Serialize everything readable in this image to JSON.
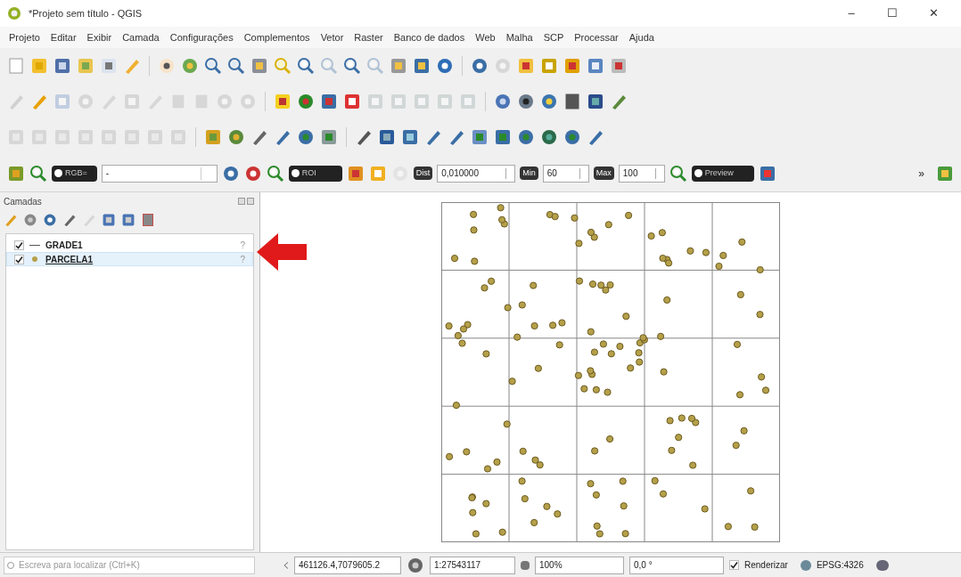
{
  "window": {
    "title": "*Projeto sem título - QGIS",
    "controls": [
      "–",
      "☐",
      "✕"
    ]
  },
  "menu": [
    "Projeto",
    "Editar",
    "Exibir",
    "Camada",
    "Configurações",
    "Complementos",
    "Vetor",
    "Raster",
    "Banco de dados",
    "Web",
    "Malha",
    "SCP",
    "Processar",
    "Ajuda"
  ],
  "scp_toolbar": {
    "band_set": "RGB=",
    "band_value": "-",
    "roi_label": "ROI",
    "dist_label": "Dist",
    "dist_value": "0,010000",
    "min_label": "Min",
    "min_value": "60",
    "max_label": "Max",
    "max_value": "100",
    "preview_label": "Preview",
    "overflow": "»"
  },
  "layers_panel": {
    "title": "Camadas",
    "layers": [
      {
        "name": "GRADE1",
        "kind": "line",
        "checked": true,
        "selected": false,
        "indicator": "?"
      },
      {
        "name": "PARCELA1",
        "kind": "point",
        "checked": true,
        "selected": true,
        "indicator": "?"
      }
    ]
  },
  "status_bar": {
    "search_placeholder": "Escreva para localizar (Ctrl+K)",
    "coordinate": "461126.4,7079605.2",
    "scale": "1:27543117",
    "magnifier": "100%",
    "rotation": "0,0 °",
    "render_checked": true,
    "render_label": "Renderizar",
    "crs": "EPSG:4326"
  }
}
